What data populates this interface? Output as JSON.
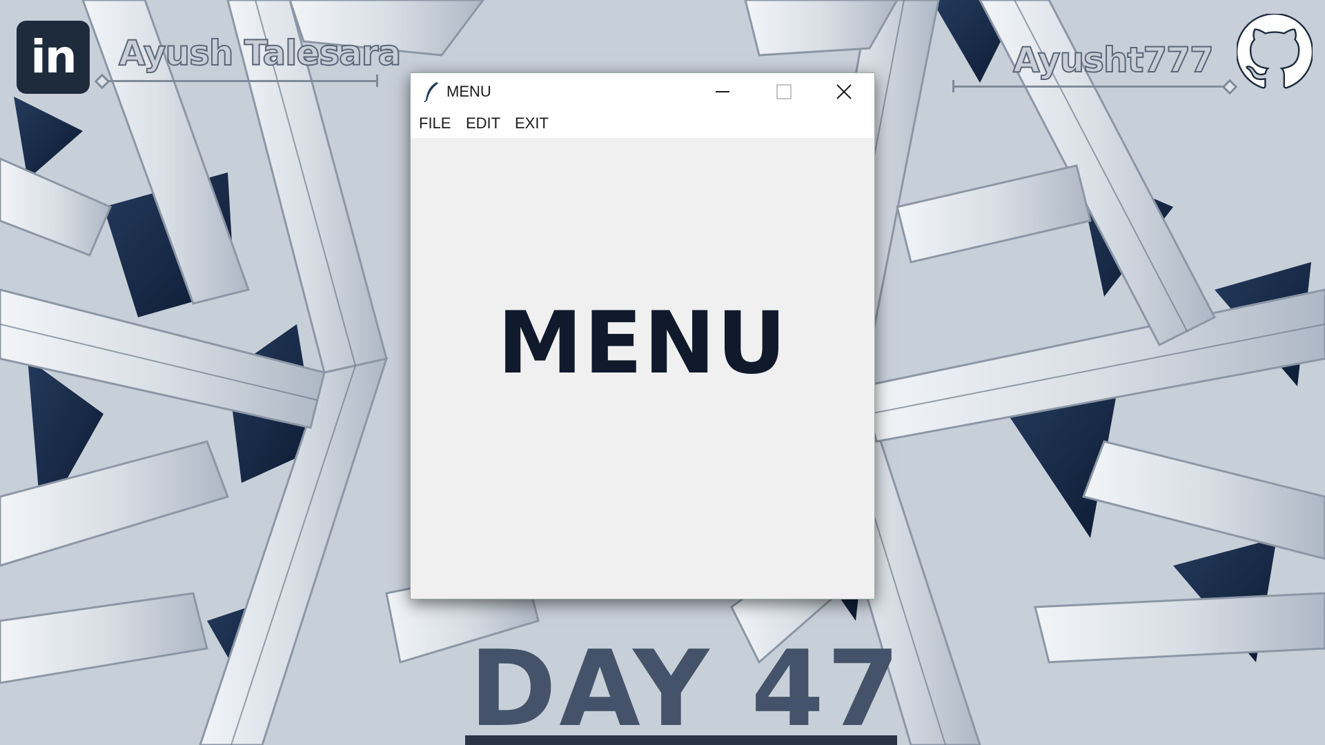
{
  "background": {
    "description_colors": {
      "light": "#dfe4ea",
      "mid": "#aab5c2",
      "dark": "#0f2240"
    }
  },
  "branding": {
    "linkedin_icon": "linkedin-icon",
    "linkedin_glyph": "in",
    "linkedin_name": "Ayush Talesara",
    "github_name": "Ayusht777",
    "github_icon": "github-icon"
  },
  "window": {
    "title": "MENU",
    "icon": "feather-icon",
    "controls": [
      "minimize-icon",
      "maximize-icon",
      "close-icon"
    ],
    "menubar": [
      "FILE",
      "EDIT",
      "EXIT"
    ],
    "body_label": "MENU"
  },
  "caption": {
    "day": "DAY 47"
  },
  "colors": {
    "label_text": "#101a2c",
    "caption_text": "#45536a",
    "badge": "#1d2b3d"
  }
}
